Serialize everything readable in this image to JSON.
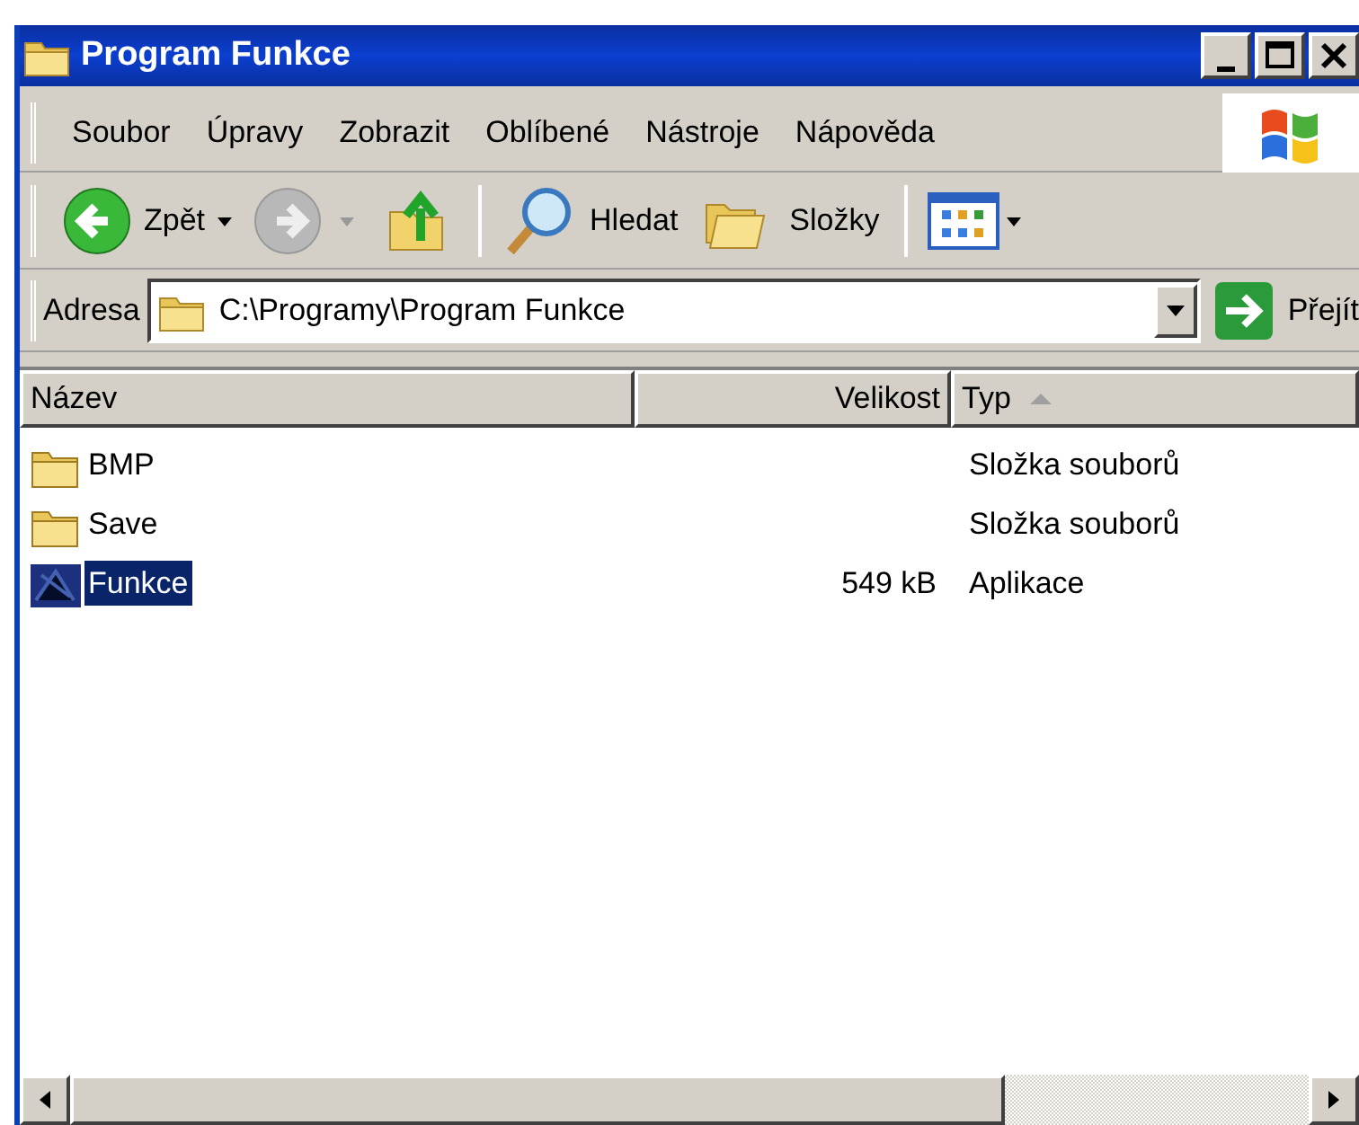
{
  "window": {
    "title": "Program Funkce"
  },
  "menu": [
    "Soubor",
    "Úpravy",
    "Zobrazit",
    "Oblíbené",
    "Nástroje",
    "Nápověda"
  ],
  "toolbar": [
    {
      "kind": "back",
      "label": "Zpět",
      "disabled": false
    },
    {
      "kind": "forward",
      "disabled": true
    },
    {
      "kind": "up"
    },
    {
      "kind": "search",
      "label": "Hledat"
    },
    {
      "kind": "folders",
      "label": "Složky"
    },
    {
      "kind": "views"
    }
  ],
  "address": {
    "label": "Adresa",
    "value": "C:\\Programy\\Program Funkce",
    "go": "Přejít"
  },
  "list": {
    "columns": [
      {
        "label": "Název",
        "sorted": false
      },
      {
        "label": "Velikost",
        "sorted": false
      },
      {
        "label": "Typ",
        "sorted": true
      }
    ],
    "rows": [
      {
        "kind": "folder",
        "name": "BMP",
        "size": "",
        "type": "Složka souborů",
        "selected": false
      },
      {
        "kind": "folder",
        "name": "Save",
        "size": "",
        "type": "Složka souborů",
        "selected": false
      },
      {
        "kind": "app",
        "name": "Funkce",
        "size": "549 kB",
        "type": "Aplikace",
        "selected": true
      }
    ]
  }
}
